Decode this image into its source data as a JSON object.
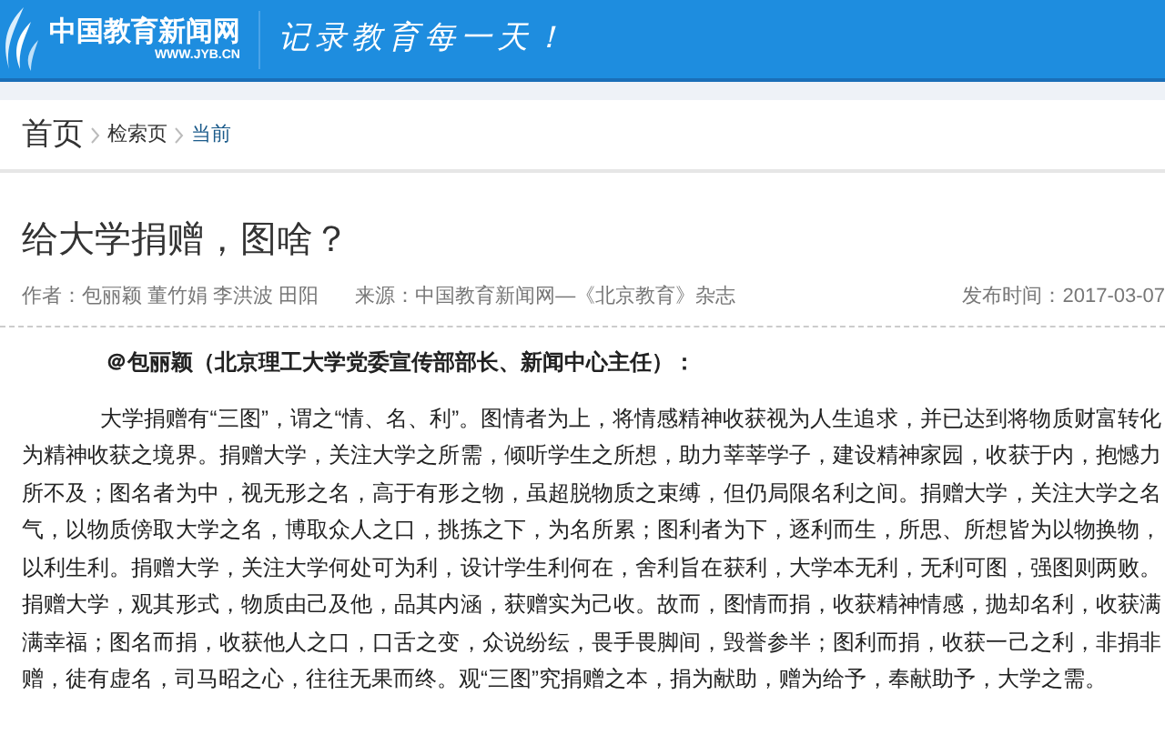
{
  "header": {
    "site_name": "中国教育新闻网",
    "site_url": "WWW.JYB.CN",
    "slogan": "记录教育每一天！"
  },
  "breadcrumb": [
    {
      "label": "首页",
      "kind": "home"
    },
    {
      "label": "检索页",
      "kind": "link"
    },
    {
      "label": "当前",
      "kind": "current"
    }
  ],
  "article": {
    "title": "给大学捐赠，图啥？",
    "authors": "作者：包丽颖 董竹娟 李洪波 田阳",
    "source": "来源：中国教育新闻网—《北京教育》杂志",
    "published": "发布时间：2017-03-07",
    "subheading": "＠包丽颖（北京理工大学党委宣传部部长、新闻中心主任）：",
    "paragraph": "大学捐赠有“三图”，谓之“情、名、利”。图情者为上，将情感精神收获视为人生追求，并已达到将物质财富转化为精神收获之境界。捐赠大学，关注大学之所需，倾听学生之所想，助力莘莘学子，建设精神家园，收获于内，抱憾力所不及；图名者为中，视无形之名，高于有形之物，虽超脱物质之束缚，但仍局限名利之间。捐赠大学，关注大学之名气，以物质傍取大学之名，博取众人之口，挑拣之下，为名所累；图利者为下，逐利而生，所思、所想皆为以物换物，以利生利。捐赠大学，关注大学何处可为利，设计学生利何在，舍利旨在获利，大学本无利，无利可图，强图则两败。捐赠大学，观其形式，物质由己及他，品其内涵，获赠实为己收。故而，图情而捐，收获精神情感，抛却名利，收获满满幸福；图名而捐，收获他人之口，口舌之变，众说纷纭，畏手畏脚间，毁誉参半；图利而捐，收获一己之利，非捐非赠，徒有虚名，司马昭之心，往往无果而终。观“三图”究捐赠之本，捐为献助，赠为给予，奉献助予，大学之需。"
  }
}
